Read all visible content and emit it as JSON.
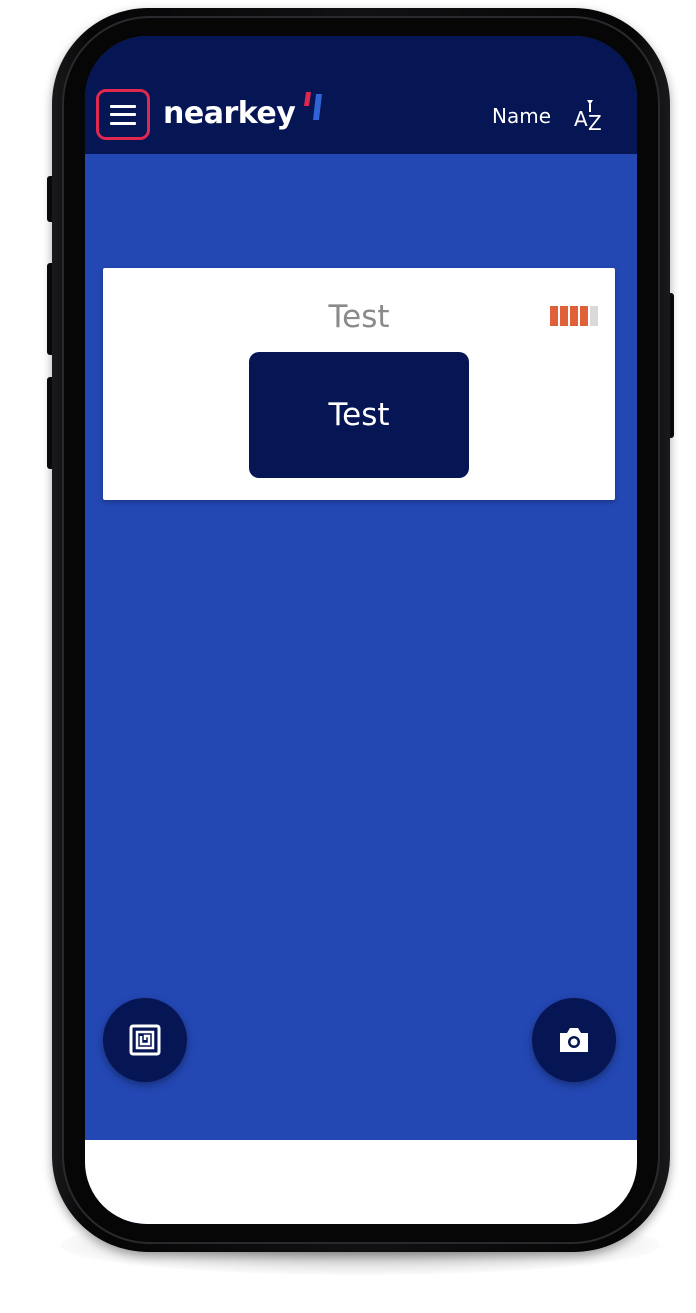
{
  "app": {
    "brand": "nearkey"
  },
  "header": {
    "sort_label": "Name",
    "sort_icon": "sort-alpha-icon",
    "sort_icon_text": "AZ",
    "menu_icon": "hamburger-menu-icon"
  },
  "card": {
    "title": "Test",
    "action_label": "Test",
    "battery_level": 0.8
  },
  "fabs": {
    "left_icon": "nfc-icon",
    "right_icon": "camera-icon"
  },
  "colors": {
    "app_bar": "#061554",
    "background": "#2347b3",
    "highlight": "#e0284f",
    "battery": "#e0603a"
  }
}
